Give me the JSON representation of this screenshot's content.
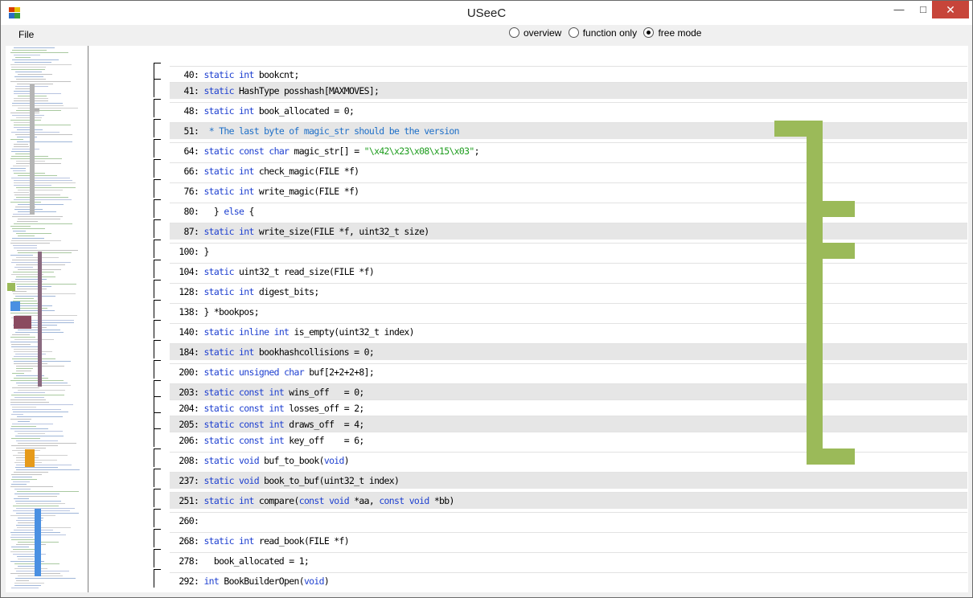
{
  "window": {
    "title": "USeeC"
  },
  "menu": {
    "file": "File"
  },
  "modes": [
    {
      "label": "overview",
      "selected": false
    },
    {
      "label": "function only",
      "selected": false
    },
    {
      "label": "free mode",
      "selected": true
    }
  ],
  "colors": {
    "keyword": "#1d3fd0",
    "string": "#1d9c1d",
    "comment": "#1e6fc8",
    "highlight": "#9bba59"
  },
  "code_lines": [
    {
      "num": "40",
      "parts": [
        [
          "kw",
          "static"
        ],
        [
          "t",
          " "
        ],
        [
          "kw",
          "int"
        ],
        [
          "t",
          " bookcnt;"
        ]
      ]
    },
    {
      "num": "41",
      "parts": [
        [
          "kw",
          "static"
        ],
        [
          "t",
          " HashType posshash[MAXMOVES];"
        ]
      ]
    },
    {
      "num": "48",
      "parts": [
        [
          "kw",
          "static"
        ],
        [
          "t",
          " "
        ],
        [
          "kw",
          "int"
        ],
        [
          "t",
          " book_allocated = 0;"
        ]
      ]
    },
    {
      "num": "51",
      "parts": [
        [
          "t",
          " "
        ],
        [
          "cm",
          "* The last byte of magic_str should be the version"
        ]
      ]
    },
    {
      "num": "64",
      "parts": [
        [
          "kw",
          "static"
        ],
        [
          "t",
          " "
        ],
        [
          "kw",
          "const"
        ],
        [
          "t",
          " "
        ],
        [
          "kw",
          "char"
        ],
        [
          "t",
          " magic_str[] = "
        ],
        [
          "str",
          "\"\\x42\\x23\\x08\\x15\\x03\""
        ],
        [
          "t",
          ";"
        ]
      ]
    },
    {
      "num": "66",
      "parts": [
        [
          "kw",
          "static"
        ],
        [
          "t",
          " "
        ],
        [
          "kw",
          "int"
        ],
        [
          "t",
          " check_magic(FILE *f)"
        ]
      ]
    },
    {
      "num": "76",
      "parts": [
        [
          "kw",
          "static"
        ],
        [
          "t",
          " "
        ],
        [
          "kw",
          "int"
        ],
        [
          "t",
          " write_magic(FILE *f)"
        ]
      ]
    },
    {
      "num": "80",
      "parts": [
        [
          "t",
          "  } "
        ],
        [
          "kw",
          "else"
        ],
        [
          "t",
          " {"
        ]
      ]
    },
    {
      "num": "87",
      "parts": [
        [
          "kw",
          "static"
        ],
        [
          "t",
          " "
        ],
        [
          "kw",
          "int"
        ],
        [
          "t",
          " write_size(FILE *f, uint32_t size)"
        ]
      ]
    },
    {
      "num": "100",
      "parts": [
        [
          "t",
          "}"
        ]
      ]
    },
    {
      "num": "104",
      "parts": [
        [
          "kw",
          "static"
        ],
        [
          "t",
          " uint32_t read_size(FILE *f)"
        ]
      ]
    },
    {
      "num": "128",
      "parts": [
        [
          "kw",
          "static"
        ],
        [
          "t",
          " "
        ],
        [
          "kw",
          "int"
        ],
        [
          "t",
          " digest_bits;"
        ]
      ]
    },
    {
      "num": "138",
      "parts": [
        [
          "t",
          "} *bookpos;"
        ]
      ]
    },
    {
      "num": "140",
      "parts": [
        [
          "kw",
          "static"
        ],
        [
          "t",
          " "
        ],
        [
          "kw",
          "inline"
        ],
        [
          "t",
          " "
        ],
        [
          "kw",
          "int"
        ],
        [
          "t",
          " is_empty(uint32_t index)"
        ]
      ]
    },
    {
      "num": "184",
      "parts": [
        [
          "kw",
          "static"
        ],
        [
          "t",
          " "
        ],
        [
          "kw",
          "int"
        ],
        [
          "t",
          " bookhashcollisions = 0;"
        ]
      ]
    },
    {
      "num": "200",
      "parts": [
        [
          "kw",
          "static"
        ],
        [
          "t",
          " "
        ],
        [
          "kw",
          "unsigned"
        ],
        [
          "t",
          " "
        ],
        [
          "kw",
          "char"
        ],
        [
          "t",
          " buf[2+2+2+8];"
        ]
      ]
    },
    {
      "num": "203",
      "parts": [
        [
          "kw",
          "static"
        ],
        [
          "t",
          " "
        ],
        [
          "kw",
          "const"
        ],
        [
          "t",
          " "
        ],
        [
          "kw",
          "int"
        ],
        [
          "t",
          " wins_off   = 0;"
        ]
      ]
    },
    {
      "num": "204",
      "parts": [
        [
          "kw",
          "static"
        ],
        [
          "t",
          " "
        ],
        [
          "kw",
          "const"
        ],
        [
          "t",
          " "
        ],
        [
          "kw",
          "int"
        ],
        [
          "t",
          " losses_off = 2;"
        ]
      ]
    },
    {
      "num": "205",
      "parts": [
        [
          "kw",
          "static"
        ],
        [
          "t",
          " "
        ],
        [
          "kw",
          "const"
        ],
        [
          "t",
          " "
        ],
        [
          "kw",
          "int"
        ],
        [
          "t",
          " draws_off  = 4;"
        ]
      ]
    },
    {
      "num": "206",
      "parts": [
        [
          "kw",
          "static"
        ],
        [
          "t",
          " "
        ],
        [
          "kw",
          "const"
        ],
        [
          "t",
          " "
        ],
        [
          "kw",
          "int"
        ],
        [
          "t",
          " key_off    = 6;"
        ]
      ]
    },
    {
      "num": "208",
      "parts": [
        [
          "kw",
          "static"
        ],
        [
          "t",
          " "
        ],
        [
          "kw",
          "void"
        ],
        [
          "t",
          " buf_to_book("
        ],
        [
          "kw",
          "void"
        ],
        [
          "t",
          ")"
        ]
      ]
    },
    {
      "num": "237",
      "parts": [
        [
          "kw",
          "static"
        ],
        [
          "t",
          " "
        ],
        [
          "kw",
          "void"
        ],
        [
          "t",
          " book_to_buf(uint32_t index)"
        ]
      ]
    },
    {
      "num": "251",
      "parts": [
        [
          "kw",
          "static"
        ],
        [
          "t",
          " "
        ],
        [
          "kw",
          "int"
        ],
        [
          "t",
          " compare("
        ],
        [
          "kw",
          "const"
        ],
        [
          "t",
          " "
        ],
        [
          "kw",
          "void"
        ],
        [
          "t",
          " *aa, "
        ],
        [
          "kw",
          "const"
        ],
        [
          "t",
          " "
        ],
        [
          "kw",
          "void"
        ],
        [
          "t",
          " *bb)"
        ]
      ]
    },
    {
      "num": "260",
      "parts": [
        [
          "t",
          ""
        ]
      ]
    },
    {
      "num": "268",
      "parts": [
        [
          "kw",
          "static"
        ],
        [
          "t",
          " "
        ],
        [
          "kw",
          "int"
        ],
        [
          "t",
          " read_book(FILE *f)"
        ]
      ]
    },
    {
      "num": "278",
      "parts": [
        [
          "t",
          "  book_allocated = 1;"
        ]
      ]
    },
    {
      "num": "292",
      "parts": [
        [
          "kw",
          "int"
        ],
        [
          "t",
          " BookBuilderOpen("
        ],
        [
          "kw",
          "void"
        ],
        [
          "t",
          ")"
        ]
      ]
    }
  ]
}
